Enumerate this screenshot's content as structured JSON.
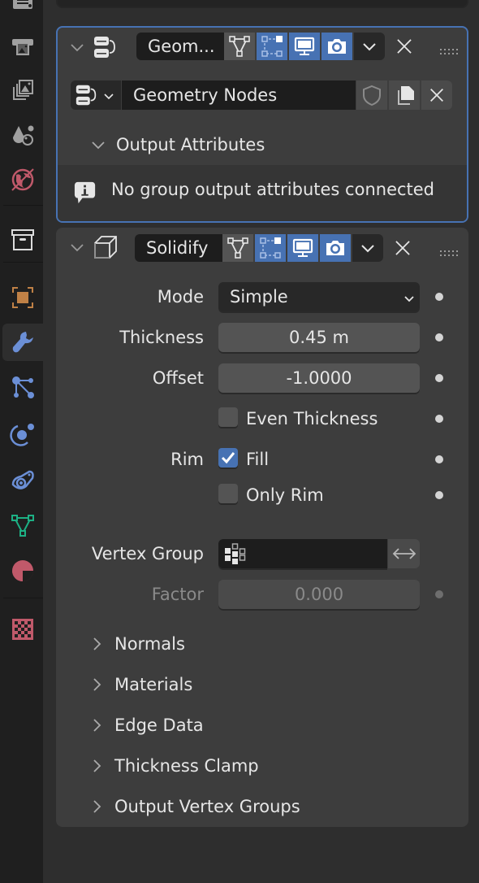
{
  "sidebar": {
    "tabs": [
      {
        "name": "output",
        "icon": "printer-icon"
      },
      {
        "name": "view-layer",
        "icon": "image-stack-icon"
      },
      {
        "name": "scene",
        "icon": "scene-icon"
      },
      {
        "name": "world",
        "icon": "world-icon"
      },
      {
        "name": "collection",
        "icon": "collection-box-icon"
      },
      {
        "name": "object",
        "icon": "object-icon"
      },
      {
        "name": "modifiers",
        "icon": "wrench-icon",
        "active": true
      },
      {
        "name": "particles",
        "icon": "particles-icon"
      },
      {
        "name": "physics",
        "icon": "physics-icon"
      },
      {
        "name": "constraints",
        "icon": "constraint-icon"
      },
      {
        "name": "data",
        "icon": "mesh-data-icon"
      },
      {
        "name": "material",
        "icon": "material-icon"
      },
      {
        "name": "texture",
        "icon": "checker-texture-icon"
      }
    ],
    "colors": {
      "gray": "#a0a0a0",
      "blue": "#6b8fd6",
      "orange": "#c08146",
      "red": "#c0596a",
      "green": "#1db084"
    }
  },
  "geometry_nodes_modifier": {
    "name": "Geom...",
    "node_group": "Geometry Nodes",
    "subpanel": "Output Attributes",
    "info_message": "No group output attributes connected",
    "toggles": {
      "edit_mode_cage": false,
      "edit_mode": true,
      "viewport": true,
      "render": true
    }
  },
  "solidify_modifier": {
    "name": "Solidify",
    "toggles": {
      "edit_mode_cage": false,
      "edit_mode": true,
      "viewport": true,
      "render": true
    },
    "fields": {
      "mode_label": "Mode",
      "mode_value": "Simple",
      "thickness_label": "Thickness",
      "thickness_value": "0.45 m",
      "offset_label": "Offset",
      "offset_value": "-1.0000",
      "even_thickness_label": "Even Thickness",
      "even_thickness": false,
      "rim_label": "Rim",
      "fill_label": "Fill",
      "fill": true,
      "only_rim_label": "Only Rim",
      "only_rim": false,
      "vertex_group_label": "Vertex Group",
      "vertex_group_value": "",
      "factor_label": "Factor",
      "factor_value": "0.000"
    },
    "subpanels": [
      "Normals",
      "Materials",
      "Edge Data",
      "Thickness Clamp",
      "Output Vertex Groups"
    ]
  },
  "colors": {
    "accent": "#4772b3",
    "panel": "#3d3d3d",
    "background": "#2e2e2e",
    "sidebar": "#1f1f1f"
  }
}
